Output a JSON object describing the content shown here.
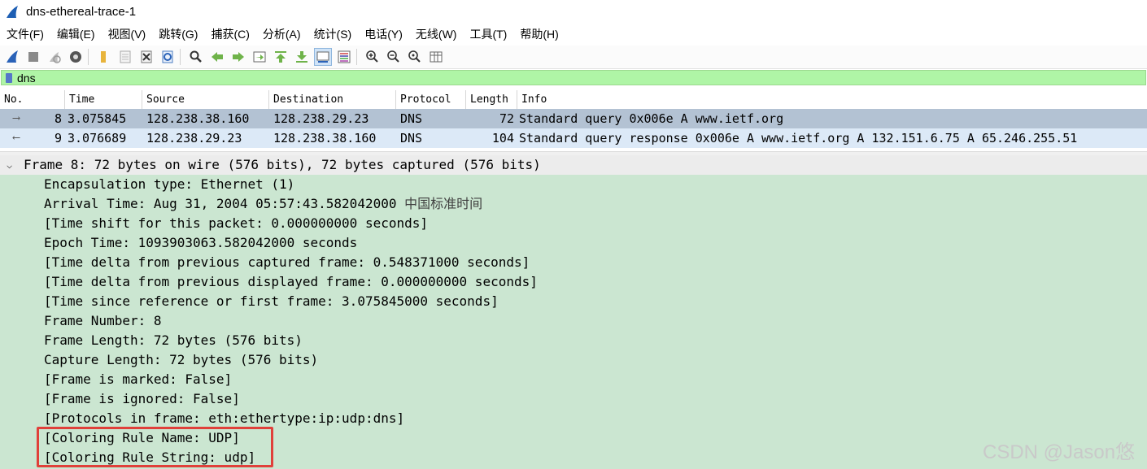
{
  "window": {
    "title": "dns-ethereal-trace-1"
  },
  "menu": [
    "文件(F)",
    "编辑(E)",
    "视图(V)",
    "跳转(G)",
    "捕获(C)",
    "分析(A)",
    "统计(S)",
    "电话(Y)",
    "无线(W)",
    "工具(T)",
    "帮助(H)"
  ],
  "toolbar": {
    "icons": [
      "start-capture-icon",
      "stop-capture-icon",
      "restart-capture-icon",
      "capture-options-icon",
      "open-file-icon",
      "save-file-icon",
      "close-file-icon",
      "reload-file-icon",
      "find-packet-icon",
      "go-back-icon",
      "go-forward-icon",
      "go-to-packet-icon",
      "first-packet-icon",
      "last-packet-icon",
      "auto-scroll-icon",
      "colorize-icon",
      "zoom-in-icon",
      "zoom-out-icon",
      "zoom-normal-icon",
      "resize-columns-icon"
    ]
  },
  "filter": {
    "value": "dns"
  },
  "packet_list": {
    "columns": [
      "No.",
      "Time",
      "Source",
      "Destination",
      "Protocol",
      "Length",
      "Info"
    ],
    "rows": [
      {
        "no": "8",
        "time": "3.075845",
        "source": "128.238.38.160",
        "destination": "128.238.29.23",
        "protocol": "DNS",
        "length": "72",
        "info": "Standard query 0x006e A www.ietf.org",
        "selected": true
      },
      {
        "no": "9",
        "time": "3.076689",
        "source": "128.238.29.23",
        "destination": "128.238.38.160",
        "protocol": "DNS",
        "length": "104",
        "info": "Standard query response 0x006e A www.ietf.org A 132.151.6.75 A 65.246.255.51",
        "selected": false
      }
    ]
  },
  "details": {
    "header": "Frame 8: 72 bytes on wire (576 bits), 72 bytes captured (576 bits)",
    "arrival_prefix": "Arrival Time: Aug 31, 2004 05:57:43.582042000",
    "arrival_tz": "中国标准时间",
    "lines": [
      "Encapsulation type: Ethernet (1)",
      "[Time shift for this packet: 0.000000000 seconds]",
      "Epoch Time: 1093903063.582042000 seconds",
      "[Time delta from previous captured frame: 0.548371000 seconds]",
      "[Time delta from previous displayed frame: 0.000000000 seconds]",
      "[Time since reference or first frame: 3.075845000 seconds]",
      "Frame Number: 8",
      "Frame Length: 72 bytes (576 bits)",
      "Capture Length: 72 bytes (576 bits)",
      "[Frame is marked: False]",
      "[Frame is ignored: False]",
      "[Protocols in frame: eth:ethertype:ip:udp:dns]",
      "[Coloring Rule Name: UDP]",
      "[Coloring Rule String: udp]"
    ]
  },
  "watermark": "CSDN @Jason悠",
  "colors": {
    "filter_bg": "#aff5a6",
    "selected_row": "#b3c2d3",
    "other_row": "#dce9f7",
    "detail_bg": "#cbe6d1",
    "highlight_border": "#e0403a"
  }
}
